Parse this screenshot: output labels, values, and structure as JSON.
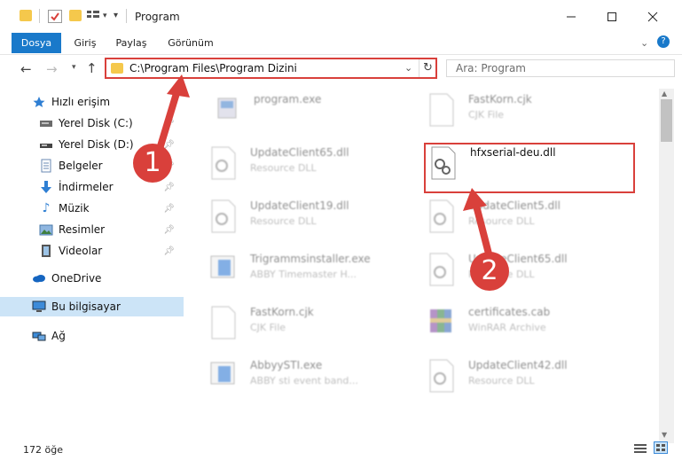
{
  "window": {
    "title": "Program"
  },
  "ribbon": {
    "tabs": [
      "Dosya",
      "Giriş",
      "Paylaş",
      "Görünüm"
    ]
  },
  "address": {
    "path": "C:\\Program Files\\Program Dizini"
  },
  "search": {
    "placeholder": "Ara: Program"
  },
  "sidebar": {
    "items": [
      {
        "label": "Hızlı erişim",
        "icon": "star-icon"
      },
      {
        "label": "Yerel Disk (C:)",
        "icon": "drive-icon",
        "pinned": true
      },
      {
        "label": "Yerel Disk (D:)",
        "icon": "drive-icon",
        "pinned": true
      },
      {
        "label": "Belgeler",
        "icon": "documents-icon",
        "pinned": true
      },
      {
        "label": "İndirmeler",
        "icon": "download-icon",
        "pinned": true
      },
      {
        "label": "Müzik",
        "icon": "music-icon",
        "pinned": true
      },
      {
        "label": "Resimler",
        "icon": "pictures-icon",
        "pinned": true
      },
      {
        "label": "Videolar",
        "icon": "videos-icon",
        "pinned": true
      },
      {
        "label": "OneDrive",
        "icon": "cloud-icon"
      },
      {
        "label": "Bu bilgisayar",
        "icon": "computer-icon",
        "selected": true
      },
      {
        "label": "Ağ",
        "icon": "network-icon"
      }
    ]
  },
  "files": {
    "left": [
      {
        "name": "program.exe",
        "type": ""
      },
      {
        "name": "UpdateClient65.dll",
        "type": "Resource DLL"
      },
      {
        "name": "UpdateClient19.dll",
        "type": "Resource DLL"
      },
      {
        "name": "Trigrammsinstaller.exe",
        "type": "ABBY Timemaster H..."
      },
      {
        "name": "FastKorn.cjk",
        "type": "CJK File"
      },
      {
        "name": "AbbyySTI.exe",
        "type": "ABBY sti event band..."
      }
    ],
    "right": [
      {
        "name": "FastKorn.cjk",
        "type": "CJK File"
      },
      {
        "name": "hfxserial-deu.dll",
        "type": ""
      },
      {
        "name": "UpdateClient5.dll",
        "type": "Resource DLL"
      },
      {
        "name": "UpdateClient65.dll",
        "type": "Resource DLL"
      },
      {
        "name": "certificates.cab",
        "type": "WinRAR Archive"
      },
      {
        "name": "UpdateClient42.dll",
        "type": "Resource DLL"
      }
    ]
  },
  "status": {
    "count": "172 öğe"
  },
  "callouts": {
    "one": "1",
    "two": "2"
  },
  "colors": {
    "accent": "#1979ca",
    "highlight": "#d9403b"
  }
}
